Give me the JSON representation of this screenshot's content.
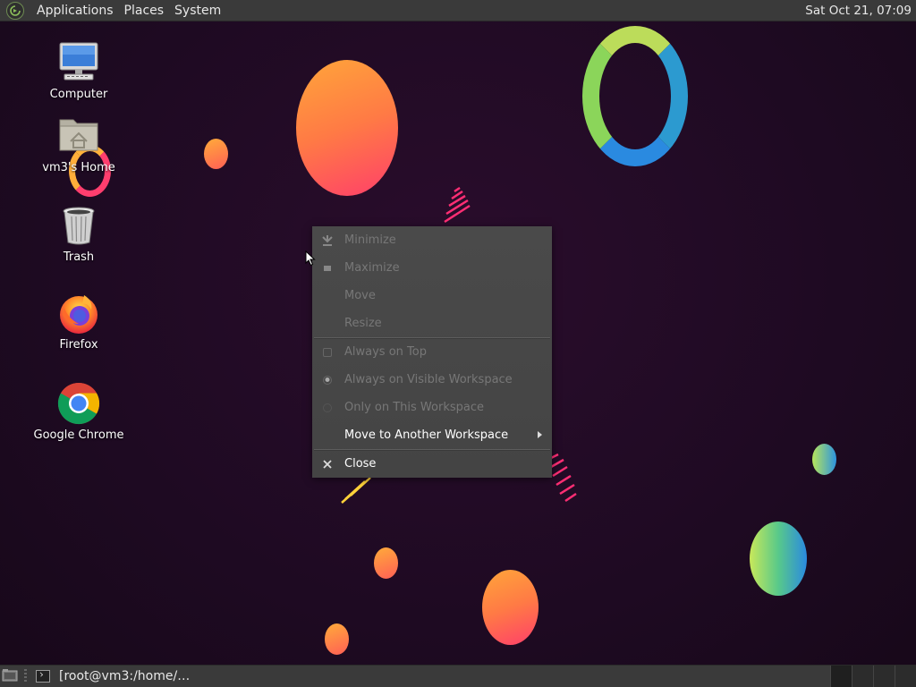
{
  "top_panel": {
    "menus": [
      "Applications",
      "Places",
      "System"
    ],
    "clock": "Sat Oct 21, 07:09",
    "logo_icon": "mate-logo-icon"
  },
  "desktop_icons": [
    {
      "label": "Computer",
      "icon": "computer-icon"
    },
    {
      "label": "vm3's Home",
      "icon": "home-folder-icon"
    },
    {
      "label": "Trash",
      "icon": "trash-icon"
    },
    {
      "label": "Firefox",
      "icon": "firefox-icon"
    },
    {
      "label": "Google Chrome",
      "icon": "chrome-icon"
    }
  ],
  "context_menu": {
    "items": [
      {
        "label": "Minimize",
        "enabled": false,
        "icon": "minimize-icon"
      },
      {
        "label": "Maximize",
        "enabled": false,
        "icon": "maximize-icon"
      },
      {
        "label": "Move",
        "enabled": false
      },
      {
        "label": "Resize",
        "enabled": false
      },
      {
        "label": "Always on Top",
        "enabled": false,
        "icon": "checkbox-icon"
      },
      {
        "label": "Always on Visible Workspace",
        "enabled": false,
        "icon": "radio-filled-icon"
      },
      {
        "label": "Only on This Workspace",
        "enabled": false,
        "icon": "radio-empty-icon"
      },
      {
        "label": "Move to Another Workspace",
        "enabled": true,
        "submenu": true
      },
      {
        "label": "Close",
        "enabled": true,
        "icon": "close-icon"
      }
    ]
  },
  "bottom_panel": {
    "task_label": "[root@vm3:/home/…",
    "workspace_count": 4,
    "active_workspace": 1
  },
  "colors": {
    "panel": "#3a3a3a",
    "menu_bg": "#474747",
    "disabled_text": "#777777",
    "wallpaper": "#1e0a22"
  }
}
